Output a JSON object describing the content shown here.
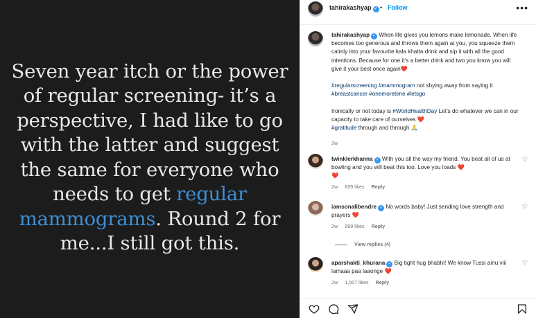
{
  "post_image": {
    "text_before": "Seven year itch or the power of regular screening- it’s a perspective, I had like to go with the latter and suggest the same for everyone who needs to get ",
    "highlight": "regular mammograms",
    "text_after": ". Round 2 for me...I still got this."
  },
  "header": {
    "username": "tahirakashyap",
    "separator": "•",
    "follow_label": "Follow",
    "more_icon": "more-horizontal-icon"
  },
  "caption": {
    "username": "tahirakashyap",
    "text1": "When life gives you lemons make lemonade. When life becomes too generous and throws them again at you, you squeeze them calmly into your favourite kala khatta drink and sip it with all the good intentions. Because for one it’s a better drink and two you know you will give it your best once again",
    "text1_emoji": "❤️",
    "tags1": "#regularscreening #mammogram",
    "text2": " not shying away from saying it",
    "tags2": "#breastcancer #onemoretime #letsgo",
    "text3": "Ironically or not today is ",
    "tag3": "#WorldHealthDay",
    "text4": " Let’s do whatever we can in our capacity to take care of ourselves ",
    "text4_emoji": "❤️",
    "tag5": "#gratitude",
    "text5": " through and through ",
    "text5_emoji": "🙏",
    "time": "2w"
  },
  "comments": [
    {
      "username": "twinklerkhanna",
      "text": "With you all the way my friend. You beat all of us at bowling and you will beat this too. Love you loads",
      "emoji": "❤️",
      "emoji2": "❤️",
      "time": "2w",
      "likes": "839 likes",
      "reply": "Reply"
    },
    {
      "username": "iamsonalibendre",
      "text": "No words baby! Just sending love strength and prayers",
      "emoji": "❤️",
      "time": "2w",
      "likes": "999 likes",
      "reply": "Reply",
      "view_replies": "View replies (4)"
    },
    {
      "username": "aparshakti_khurana",
      "text": "Big tight hug bhabhi! We know Tussi ainu viii lamaaa paa laaonge",
      "emoji": "❤️",
      "time": "2w",
      "likes": "1,507 likes",
      "reply": "Reply"
    }
  ],
  "actions": {
    "like_icon": "heart-icon",
    "comment_icon": "comment-icon",
    "share_icon": "share-icon",
    "save_icon": "bookmark-icon"
  },
  "colors": {
    "image_bg": "#1c1c1c",
    "image_text": "#e8e8e8",
    "highlight": "#3d8fd6",
    "link_blue": "#0095f6",
    "hashtag": "#00376b",
    "heart": "#ed4956"
  }
}
